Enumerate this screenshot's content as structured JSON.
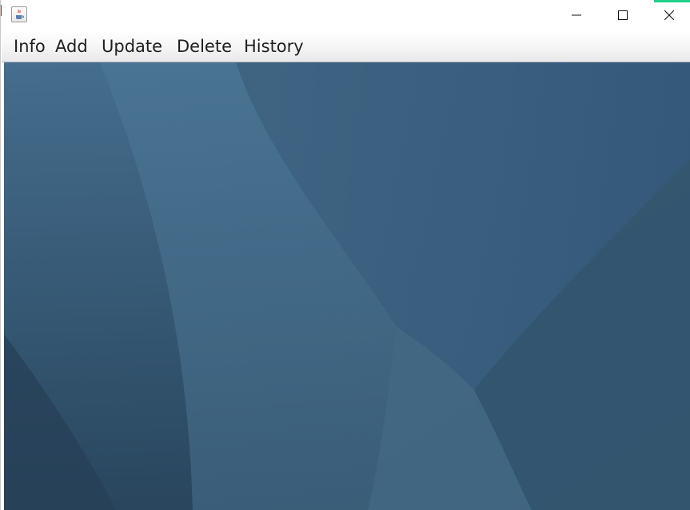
{
  "window": {
    "icon": "java-cup-icon",
    "controls": {
      "minimize": "minimize-icon",
      "maximize": "maximize-icon",
      "close": "close-icon"
    }
  },
  "menu": {
    "items": [
      {
        "label": "Info"
      },
      {
        "label": "Add"
      },
      {
        "label": "Update"
      },
      {
        "label": "Delete"
      },
      {
        "label": "History"
      }
    ]
  },
  "desktop": {
    "background_color": "#3b5f7b"
  }
}
